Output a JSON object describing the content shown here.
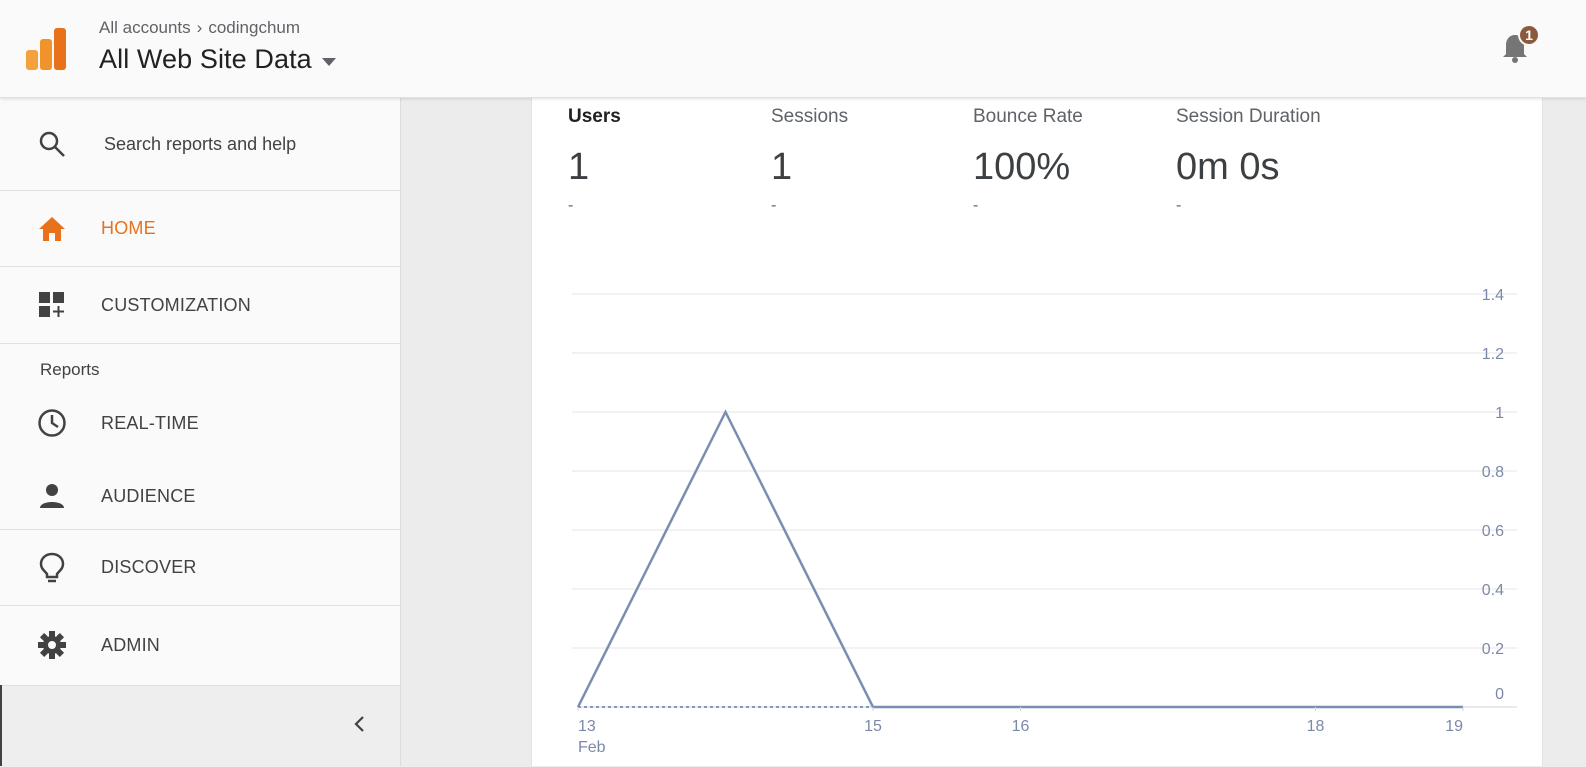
{
  "header": {
    "breadcrumb_root": "All accounts",
    "breadcrumb_account": "codingchum",
    "property_name": "All Web Site Data",
    "notifications_count": "1"
  },
  "sidebar": {
    "search_placeholder": "Search reports and help",
    "home_label": "HOME",
    "customization_label": "CUSTOMIZATION",
    "reports_section_label": "Reports",
    "realtime_label": "REAL-TIME",
    "audience_label": "AUDIENCE",
    "discover_label": "DISCOVER",
    "admin_label": "ADMIN"
  },
  "metrics": [
    {
      "label": "Users",
      "value": "1",
      "change": "-"
    },
    {
      "label": "Sessions",
      "value": "1",
      "change": "-"
    },
    {
      "label": "Bounce Rate",
      "value": "100%",
      "change": "-"
    },
    {
      "label": "Session Duration",
      "value": "0m 0s",
      "change": "-"
    }
  ],
  "colors": {
    "accent": "#e8711a",
    "line": "#7b8db0",
    "axis_text": "#7b89a8"
  },
  "chart_data": {
    "type": "line",
    "x": [
      "13",
      "14",
      "15",
      "16",
      "17",
      "18",
      "19"
    ],
    "x_tick_labels": [
      "13",
      "15",
      "16",
      "18",
      "19"
    ],
    "x_sublabel": "Feb",
    "series": [
      {
        "values": [
          0,
          1,
          0,
          0,
          0,
          0,
          0
        ]
      }
    ],
    "ylim": [
      0,
      1.4
    ],
    "y_ticks": [
      "0",
      "0.2",
      "0.4",
      "0.6",
      "0.8",
      "1",
      "1.2",
      "1.4"
    ],
    "grid": true
  }
}
